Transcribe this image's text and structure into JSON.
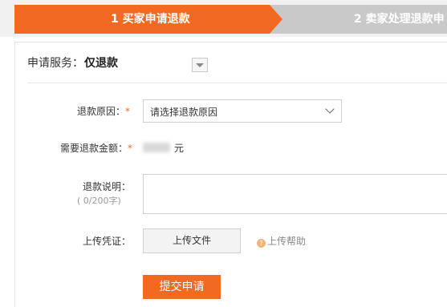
{
  "steps": [
    {
      "label": "1 买家申请退款",
      "state": "active"
    },
    {
      "label": "2 卖家处理退款申",
      "state": "inactive"
    }
  ],
  "colors": {
    "accent": "#f26a21",
    "inactive_step": "#c9c9c9"
  },
  "service": {
    "label": "申请服务：",
    "value": "仅退款"
  },
  "form": {
    "reason": {
      "label": "退款原因：",
      "required_mark": "*",
      "placeholder": "请选择退款原因"
    },
    "amount": {
      "label": "需要退款金额：",
      "required_mark": "*",
      "unit": "元"
    },
    "description": {
      "label": "退款说明：",
      "counter": "( 0/200字)"
    },
    "voucher": {
      "label": "上传凭证：",
      "upload_button": "上传文件",
      "help_icon": "?",
      "help": "上传帮助"
    }
  },
  "submit": {
    "label": "提交申请"
  }
}
